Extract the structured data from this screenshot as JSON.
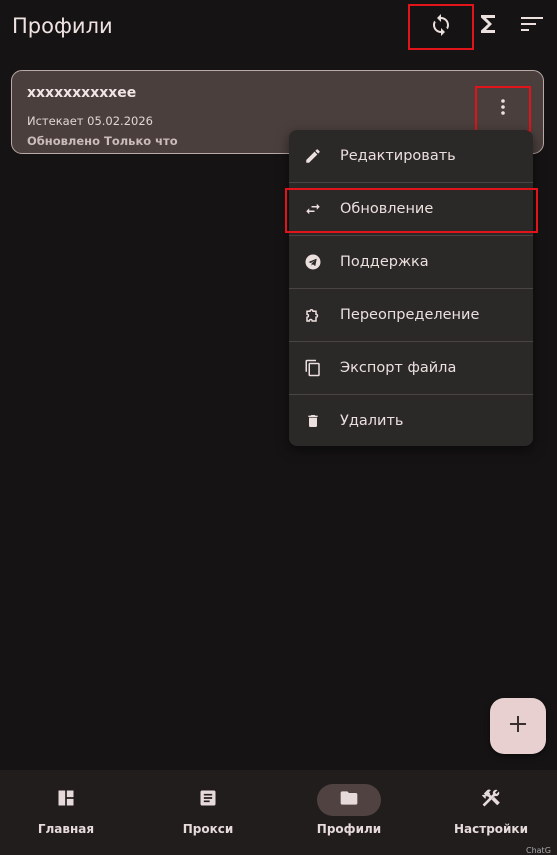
{
  "header": {
    "title": "Профили",
    "sync_icon": "sync-icon",
    "sum_icon": "sigma-icon",
    "sort_icon": "sort-icon"
  },
  "profile_card": {
    "name": "xxxxxxxxxxee",
    "expires": "Истекает 05.02.2026",
    "updated": "Обновлено Только что",
    "menu_icon": "more-vert-icon"
  },
  "context_menu": {
    "items": [
      {
        "label": "Редактировать",
        "icon": "edit-icon"
      },
      {
        "label": "Обновление",
        "icon": "swap-icon"
      },
      {
        "label": "Поддержка",
        "icon": "telegram-icon"
      },
      {
        "label": "Переопределение",
        "icon": "extension-icon"
      },
      {
        "label": "Экспорт файла",
        "icon": "copy-icon"
      },
      {
        "label": "Удалить",
        "icon": "delete-icon"
      }
    ]
  },
  "fab": {
    "icon": "add-icon"
  },
  "bottom_nav": {
    "items": [
      {
        "label": "Главная",
        "icon": "dashboard-icon"
      },
      {
        "label": "Прокси",
        "icon": "article-icon"
      },
      {
        "label": "Профили",
        "icon": "folder-icon"
      },
      {
        "label": "Настройки",
        "icon": "tools-icon"
      }
    ],
    "active": "Профили"
  },
  "corner_text": "ChatG",
  "colors": {
    "background": "#151313",
    "card": "#4b3f3d",
    "menu": "#2b2828",
    "highlight": "#e0141a",
    "fab": "#e8cfd0"
  }
}
